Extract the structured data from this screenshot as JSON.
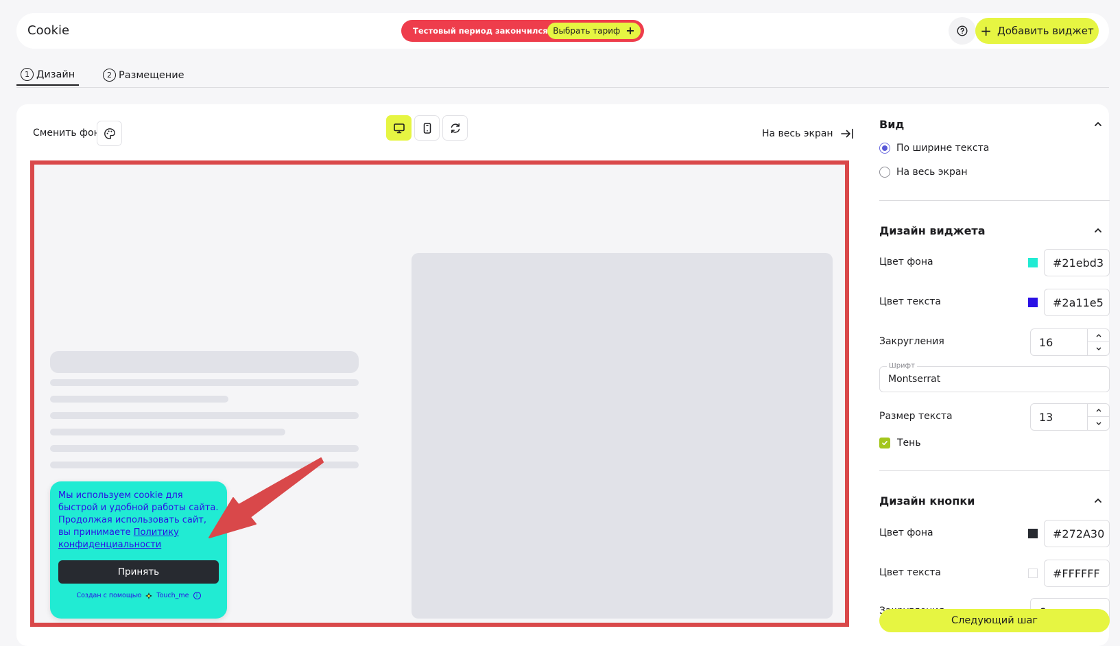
{
  "header": {
    "title": "Cookie",
    "trial_text": "Тестовый период закончился",
    "choose_plan_label": "Выбрать тариф",
    "add_widget_label": "Добавить виджет"
  },
  "tabs": [
    {
      "num": "1",
      "label": "Дизайн",
      "active": true
    },
    {
      "num": "2",
      "label": "Размещение",
      "active": false
    }
  ],
  "toolbar": {
    "change_bg_label": "Сменить фон",
    "fullscreen_label": "На весь экран",
    "device_selected": "desktop"
  },
  "cookie_widget": {
    "text": "Мы используем cookie для быстрой и удобной работы сайта. Продолжая использовать сайт, вы принимаете",
    "link_text": "Политику конфиденциальности",
    "accept_label": "Принять",
    "footer_prefix": "Создан с помощью",
    "footer_brand": "Touch_me"
  },
  "sidebar": {
    "view": {
      "title": "Вид",
      "options": [
        {
          "label": "По ширине текста",
          "selected": true
        },
        {
          "label": "На весь экран",
          "selected": false
        }
      ]
    },
    "widget_design": {
      "title": "Дизайн виджета",
      "bg_color_label": "Цвет фона",
      "bg_color": "#21ebd3",
      "text_color_label": "Цвет текста",
      "text_color": "#2a11e5",
      "radius_label": "Закругления",
      "radius": "16",
      "font_legend": "Шрифт",
      "font": "Montserrat",
      "text_size_label": "Размер текста",
      "text_size": "13",
      "shadow_label": "Тень",
      "shadow": true
    },
    "button_design": {
      "title": "Дизайн кнопки",
      "bg_color_label": "Цвет фона",
      "bg_color": "#272A30",
      "text_color_label": "Цвет текста",
      "text_color": "#FFFFFF",
      "radius_label": "Закругления",
      "radius": "6"
    },
    "next_label": "Следующий шаг"
  }
}
